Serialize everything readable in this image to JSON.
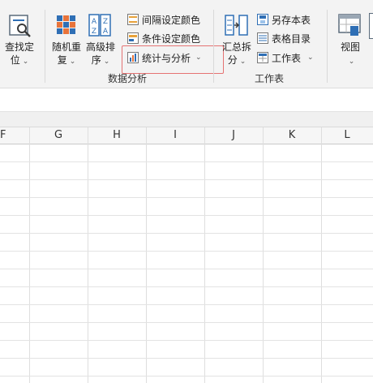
{
  "ribbon": {
    "find_locate": {
      "line1": "查找定",
      "line2": "位",
      "icon": "find-icon"
    },
    "random_repeat": {
      "line1": "随机重",
      "line2": "复",
      "icon": "random-repeat-icon"
    },
    "advanced_sort": {
      "line1": "高级排",
      "line2": "序",
      "icon": "advanced-sort-icon"
    },
    "interval_color": {
      "label": "间隔设定颜色",
      "icon": "interval-color-icon"
    },
    "condition_color": {
      "label": "条件设定颜色",
      "icon": "condition-color-icon"
    },
    "stats_analysis": {
      "label": "统计与分析",
      "icon": "stats-analysis-icon"
    },
    "data_analysis_group": "数据分析",
    "summary_split": {
      "line1": "汇总拆",
      "line2": "分",
      "icon": "summary-split-icon"
    },
    "save_as_table": {
      "label": "另存本表",
      "icon": "save-as-table-icon"
    },
    "table_directory": {
      "label": "表格目录",
      "icon": "table-directory-icon"
    },
    "worksheet": {
      "label": "工作表",
      "icon": "worksheet-icon"
    },
    "worksheet_group": "工作表",
    "view": {
      "label": "视图",
      "icon": "view-icon"
    },
    "chevron": "⌄"
  },
  "columns": [
    "F",
    "G",
    "H",
    "I",
    "J",
    "K",
    "L"
  ]
}
